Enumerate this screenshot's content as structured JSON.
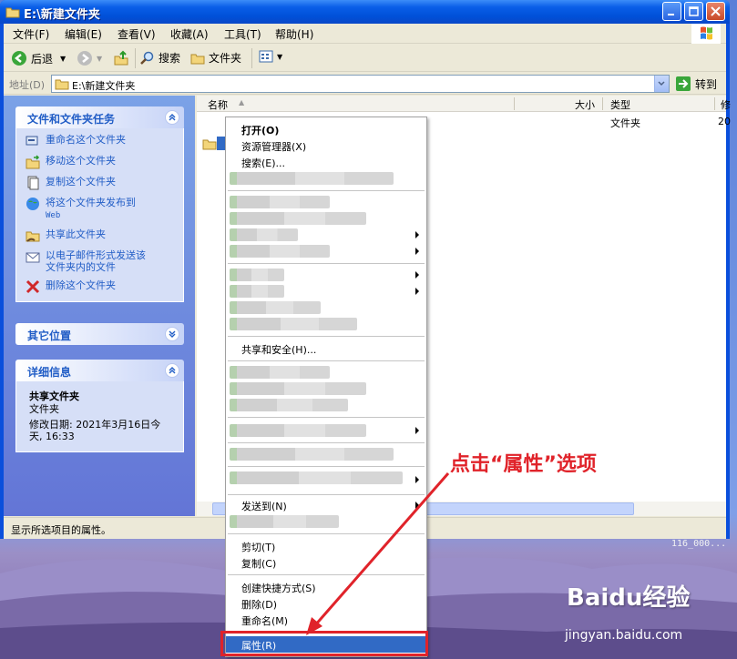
{
  "window": {
    "title": "E:\\新建文件夹",
    "buttons": [
      "minimize",
      "maximize",
      "close"
    ]
  },
  "menubar": {
    "items": [
      "文件(F)",
      "编辑(E)",
      "查看(V)",
      "收藏(A)",
      "工具(T)",
      "帮助(H)"
    ]
  },
  "toolbar": {
    "back": "后退",
    "search": "搜索",
    "folders": "文件夹"
  },
  "address": {
    "label": "地址(D)",
    "value": "E:\\新建文件夹",
    "go": "转到"
  },
  "taskpane": {
    "tasks_title": "文件和文件夹任务",
    "tasks": [
      {
        "label": "重命名这个文件夹"
      },
      {
        "label": "移动这个文件夹"
      },
      {
        "label": "复制这个文件夹"
      },
      {
        "label": "将这个文件夹发布到",
        "sub": "Web"
      },
      {
        "label": "共享此文件夹"
      },
      {
        "label": "以电子邮件形式发送该",
        "sub": "文件夹内的文件"
      },
      {
        "label": "删除这个文件夹"
      }
    ],
    "other_title": "其它位置",
    "details_title": "详细信息",
    "details": {
      "name": "共享文件夹",
      "type": "文件夹",
      "modified_line1": "修改日期: 2021年3月16日今",
      "modified_line2": "天, 16:33"
    }
  },
  "fileview": {
    "columns": [
      "名称",
      "大小",
      "类型",
      "修"
    ],
    "row": {
      "type": "文件夹",
      "modified": "20"
    }
  },
  "statusbar": {
    "text": "显示所选项目的属性。"
  },
  "context_menu": {
    "open": "打开(O)",
    "explorer": "资源管理器(X)",
    "search": "搜索(E)...",
    "sharing": "共享和安全(H)...",
    "send_to": "发送到(N)",
    "cut": "剪切(T)",
    "copy": "复制(C)",
    "create_shortcut": "创建快捷方式(S)",
    "delete": "删除(D)",
    "rename": "重命名(M)",
    "properties": "属性(R)"
  },
  "annotation": {
    "text": "点击“属性”选项",
    "color": "#e0232a"
  },
  "desktop": {
    "watermark": "Baidu经验",
    "watermark_url": "jingyan.baidu.com",
    "stray_text": "116_000..."
  },
  "colors": {
    "titlebar": "#0054e3",
    "selection": "#316ac5",
    "taskpane_link": "#215dc6"
  }
}
